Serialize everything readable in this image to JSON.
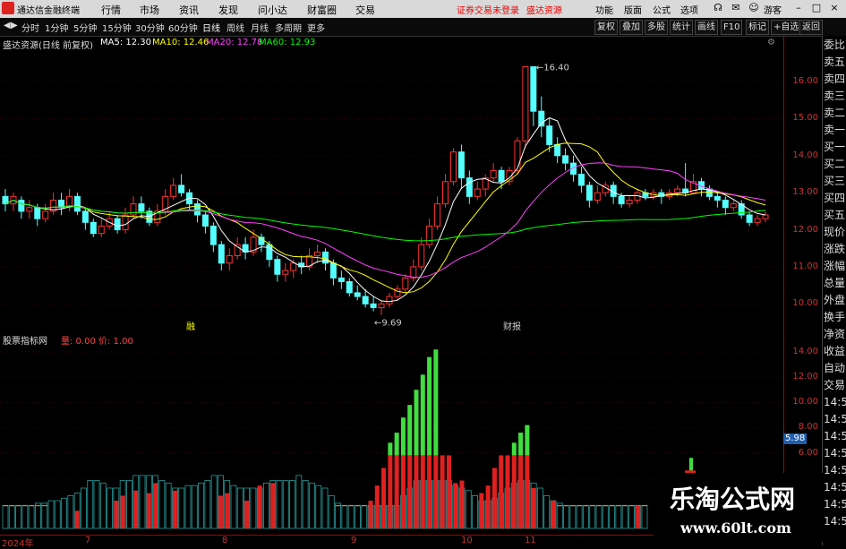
{
  "window": {
    "app_title": "通达信金融终端",
    "menu": [
      "行情",
      "市场",
      "资讯",
      "发现",
      "问小达",
      "财富圈",
      "交易"
    ],
    "trade_status": "证券交易未登录",
    "broker_link": "盛达资源",
    "right_menu": [
      "功能",
      "版面",
      "公式",
      "选项"
    ],
    "guest": "游客"
  },
  "toolbar": {
    "periods": [
      "分时",
      "1分钟",
      "5分钟",
      "15分钟",
      "30分钟",
      "60分钟",
      "日线",
      "周线",
      "月线",
      "多周期",
      "更多"
    ],
    "active_period": "日线",
    "right_buttons": [
      "复权",
      "叠加",
      "多股",
      "统计",
      "画线",
      "F10",
      "标记",
      "+自选",
      "返回"
    ]
  },
  "main": {
    "stock_title": "盛达资源(日线 前复权)",
    "ma": [
      {
        "label": "MA5: 12.30",
        "color": "#ffffff"
      },
      {
        "label": "MA10: 12.46",
        "color": "#ffff00"
      },
      {
        "label": "MA20: 12.78",
        "color": "#ff40ff"
      },
      {
        "label": "MA60: 12.93",
        "color": "#00ff00"
      }
    ],
    "high_label": "16.40",
    "low_label": "9.69",
    "price_ticks": [
      "16.00",
      "15.00",
      "14.00",
      "13.00",
      "12.00",
      "11.00",
      "10.00"
    ],
    "event_markers": [
      "融",
      "财报"
    ]
  },
  "indicator": {
    "title": "股票指标网",
    "values": "量: 0.00  价: 1.00",
    "ticks": [
      "14.00",
      "12.00",
      "10.00",
      "8.00",
      "6.00",
      "4.00"
    ],
    "current": "5.98"
  },
  "dates": [
    "2024年",
    "7",
    "8",
    "9",
    "10",
    "11"
  ],
  "right_panel": [
    "委比",
    "卖五",
    "卖四",
    "卖三",
    "卖二",
    "卖一",
    "买一",
    "买二",
    "买三",
    "买四",
    "买五",
    "现价",
    "涨跌",
    "涨幅",
    "总量",
    "外盘",
    "换手",
    "净资",
    "收益",
    "自动",
    "交易",
    "14:5",
    "14:5",
    "14:5",
    "14:5",
    "14:5",
    "14:5",
    "14:5",
    "14:5"
  ],
  "watermark": {
    "title": "乐淘公式网",
    "url": "www.60lt.com"
  },
  "chart_data": {
    "type": "candlestick",
    "ylim": [
      9.5,
      16.8
    ],
    "candles": [
      [
        12.9,
        12.7,
        13.1,
        12.5
      ],
      [
        12.7,
        12.9,
        13.0,
        12.5
      ],
      [
        12.8,
        12.5,
        12.9,
        12.3
      ],
      [
        12.5,
        12.6,
        12.8,
        12.3
      ],
      [
        12.6,
        12.3,
        12.7,
        12.1
      ],
      [
        12.3,
        12.5,
        12.7,
        12.2
      ],
      [
        12.5,
        12.8,
        13.0,
        12.4
      ],
      [
        12.8,
        12.6,
        13.0,
        12.4
      ],
      [
        12.6,
        12.9,
        13.1,
        12.5
      ],
      [
        12.9,
        12.5,
        13.0,
        12.4
      ],
      [
        12.5,
        12.2,
        12.6,
        12.0
      ],
      [
        12.2,
        11.9,
        12.3,
        11.8
      ],
      [
        11.9,
        12.1,
        12.3,
        11.8
      ],
      [
        12.1,
        12.3,
        12.5,
        12.0
      ],
      [
        12.3,
        12.0,
        12.4,
        11.9
      ],
      [
        12.0,
        12.4,
        12.6,
        11.9
      ],
      [
        12.4,
        12.7,
        12.9,
        12.3
      ],
      [
        12.7,
        12.5,
        12.9,
        12.3
      ],
      [
        12.5,
        12.2,
        12.6,
        12.1
      ],
      [
        12.2,
        12.5,
        12.7,
        12.1
      ],
      [
        12.5,
        12.9,
        13.1,
        12.4
      ],
      [
        12.9,
        13.2,
        13.4,
        12.8
      ],
      [
        13.2,
        13.0,
        13.5,
        12.9
      ],
      [
        13.0,
        12.7,
        13.1,
        12.5
      ],
      [
        12.7,
        12.4,
        12.8,
        12.2
      ],
      [
        12.4,
        12.1,
        12.5,
        11.9
      ],
      [
        12.1,
        11.6,
        12.2,
        11.4
      ],
      [
        11.6,
        11.1,
        11.7,
        10.9
      ],
      [
        11.1,
        11.3,
        11.5,
        10.9
      ],
      [
        11.3,
        11.6,
        11.8,
        11.2
      ],
      [
        11.6,
        11.4,
        11.8,
        11.2
      ],
      [
        11.4,
        11.8,
        12.0,
        11.3
      ],
      [
        11.8,
        11.6,
        11.9,
        11.4
      ],
      [
        11.6,
        11.2,
        11.7,
        11.0
      ],
      [
        11.2,
        10.8,
        11.3,
        10.6
      ],
      [
        10.8,
        10.9,
        11.1,
        10.6
      ],
      [
        10.9,
        11.1,
        11.2,
        10.7
      ],
      [
        11.1,
        11.0,
        11.3,
        10.8
      ],
      [
        11.0,
        11.3,
        11.5,
        10.9
      ],
      [
        11.3,
        11.4,
        11.6,
        11.1
      ],
      [
        11.4,
        11.1,
        11.5,
        10.9
      ],
      [
        11.1,
        10.7,
        11.2,
        10.5
      ],
      [
        10.7,
        10.6,
        10.9,
        10.4
      ],
      [
        10.6,
        10.3,
        10.7,
        10.2
      ],
      [
        10.3,
        10.2,
        10.5,
        10.1
      ],
      [
        10.2,
        10.0,
        10.4,
        9.9
      ],
      [
        10.0,
        9.9,
        10.2,
        9.8
      ],
      [
        9.9,
        10.0,
        10.1,
        9.7
      ],
      [
        10.0,
        10.2,
        10.3,
        9.9
      ],
      [
        10.2,
        10.4,
        10.5,
        10.1
      ],
      [
        10.4,
        10.7,
        10.8,
        10.3
      ],
      [
        10.7,
        11.0,
        11.2,
        10.6
      ],
      [
        11.0,
        11.6,
        11.8,
        10.9
      ],
      [
        11.6,
        12.1,
        12.3,
        11.5
      ],
      [
        12.1,
        12.7,
        12.9,
        12.0
      ],
      [
        12.7,
        13.3,
        13.5,
        12.6
      ],
      [
        13.3,
        14.1,
        14.2,
        13.2
      ],
      [
        14.1,
        13.4,
        14.3,
        13.1
      ],
      [
        13.4,
        12.9,
        13.6,
        12.7
      ],
      [
        12.9,
        13.1,
        13.3,
        12.8
      ],
      [
        13.1,
        13.4,
        13.5,
        12.9
      ],
      [
        13.4,
        13.6,
        13.8,
        13.3
      ],
      [
        13.6,
        13.3,
        13.7,
        13.1
      ],
      [
        13.3,
        13.6,
        13.7,
        13.2
      ],
      [
        13.6,
        14.4,
        14.5,
        13.5
      ],
      [
        14.4,
        16.4,
        16.4,
        14.2
      ],
      [
        16.4,
        15.2,
        16.0,
        14.8
      ],
      [
        15.2,
        14.8,
        15.6,
        14.5
      ],
      [
        14.8,
        14.3,
        15.0,
        14.1
      ],
      [
        14.3,
        14.0,
        14.5,
        13.8
      ],
      [
        14.0,
        13.8,
        14.2,
        13.6
      ],
      [
        13.8,
        13.5,
        14.0,
        13.3
      ],
      [
        13.5,
        13.2,
        13.7,
        13.0
      ],
      [
        13.2,
        12.8,
        13.3,
        12.6
      ],
      [
        12.8,
        13.0,
        13.2,
        12.7
      ],
      [
        13.0,
        13.2,
        13.3,
        12.9
      ],
      [
        13.2,
        12.9,
        13.3,
        12.7
      ],
      [
        12.9,
        12.7,
        13.0,
        12.6
      ],
      [
        12.7,
        12.8,
        12.9,
        12.6
      ],
      [
        12.8,
        13.0,
        13.1,
        12.7
      ],
      [
        13.0,
        12.9,
        13.1,
        12.8
      ],
      [
        12.9,
        13.0,
        13.1,
        12.8
      ],
      [
        13.0,
        12.9,
        13.1,
        12.7
      ],
      [
        12.9,
        13.0,
        13.1,
        12.8
      ],
      [
        13.0,
        13.1,
        13.2,
        12.9
      ],
      [
        13.1,
        13.0,
        13.8,
        12.9
      ],
      [
        13.0,
        13.3,
        13.5,
        13.0
      ],
      [
        13.3,
        13.1,
        13.4,
        12.9
      ],
      [
        13.1,
        12.9,
        13.2,
        12.8
      ],
      [
        12.9,
        12.8,
        13.0,
        12.6
      ],
      [
        12.8,
        12.6,
        12.9,
        12.4
      ],
      [
        12.6,
        12.7,
        12.8,
        12.5
      ],
      [
        12.7,
        12.4,
        12.8,
        12.3
      ],
      [
        12.4,
        12.2,
        12.5,
        12.1
      ],
      [
        12.2,
        12.3,
        12.4,
        12.1
      ],
      [
        12.3,
        12.4,
        12.5,
        12.2
      ]
    ]
  }
}
